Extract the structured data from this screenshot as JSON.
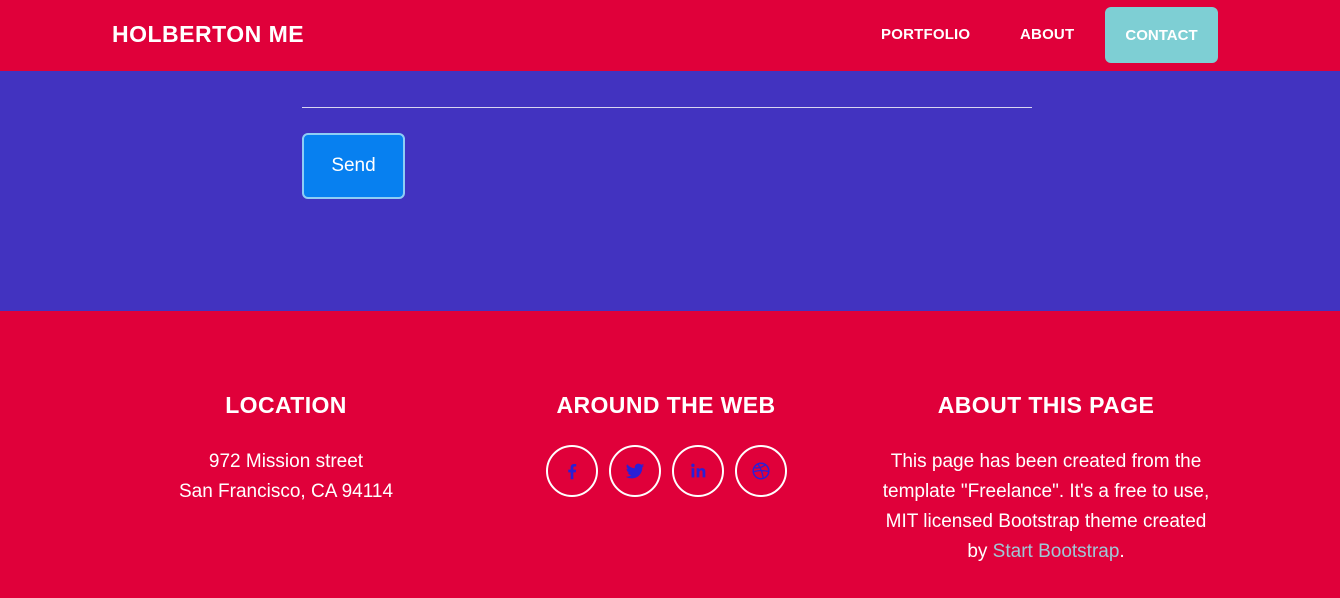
{
  "navbar": {
    "brand": "HOLBERTON ME",
    "items": [
      {
        "label": "PORTFOLIO"
      },
      {
        "label": "ABOUT"
      },
      {
        "label": "CONTACT"
      }
    ]
  },
  "contact": {
    "send_label": "Send"
  },
  "footer": {
    "location": {
      "heading": "LOCATION",
      "line1": "972 Mission street",
      "line2": "San Francisco, CA 94114"
    },
    "web": {
      "heading": "AROUND THE WEB",
      "icons": [
        "facebook-icon",
        "twitter-icon",
        "linkedin-icon",
        "dribbble-icon"
      ]
    },
    "about": {
      "heading": "ABOUT THIS PAGE",
      "text_before": "This page has been created from the template \"Freelance\". It's a free to use, MIT licensed Bootstrap theme created by ",
      "link_label": "Start Bootstrap",
      "text_after": "."
    }
  },
  "colors": {
    "primary_red": "#e0003a",
    "section_purple": "#4233c0",
    "contact_teal": "#7ecfd4",
    "send_blue": "#0780f0",
    "icon_blue": "#2a1fd6",
    "link_light": "#9fc7d6"
  }
}
